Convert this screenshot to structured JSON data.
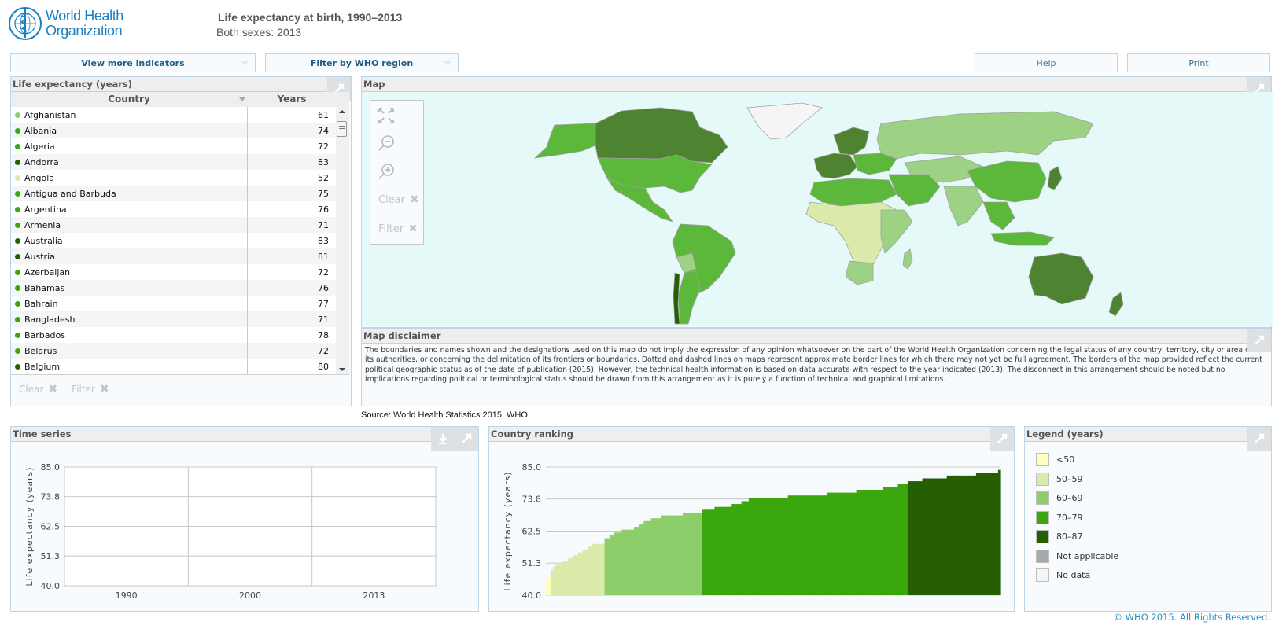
{
  "header": {
    "logo_text_line1": "World Health",
    "logo_text_line2": "Organization",
    "title": "Life expectancy at birth, 1990–2013",
    "subtitle": "Both sexes: 2013"
  },
  "toolbar": {
    "indicators_label": "View more indicators",
    "region_label": "Filter by WHO region",
    "help_label": "Help",
    "print_label": "Print"
  },
  "table_panel": {
    "title": "Life expectancy (years)",
    "col_country": "Country",
    "col_years": "Years",
    "rows": [
      {
        "country": "Afghanistan",
        "years": "61",
        "color": "#8ccf6a"
      },
      {
        "country": "Albania",
        "years": "74",
        "color": "#3aa70c"
      },
      {
        "country": "Algeria",
        "years": "72",
        "color": "#3aa70c"
      },
      {
        "country": "Andorra",
        "years": "83",
        "color": "#265f02"
      },
      {
        "country": "Angola",
        "years": "52",
        "color": "#d9eaab"
      },
      {
        "country": "Antigua and Barbuda",
        "years": "75",
        "color": "#3aa70c"
      },
      {
        "country": "Argentina",
        "years": "76",
        "color": "#3aa70c"
      },
      {
        "country": "Armenia",
        "years": "71",
        "color": "#3aa70c"
      },
      {
        "country": "Australia",
        "years": "83",
        "color": "#265f02"
      },
      {
        "country": "Austria",
        "years": "81",
        "color": "#265f02"
      },
      {
        "country": "Azerbaijan",
        "years": "72",
        "color": "#3aa70c"
      },
      {
        "country": "Bahamas",
        "years": "76",
        "color": "#3aa70c"
      },
      {
        "country": "Bahrain",
        "years": "77",
        "color": "#3aa70c"
      },
      {
        "country": "Bangladesh",
        "years": "71",
        "color": "#3aa70c"
      },
      {
        "country": "Barbados",
        "years": "78",
        "color": "#3aa70c"
      },
      {
        "country": "Belarus",
        "years": "72",
        "color": "#3aa70c"
      },
      {
        "country": "Belgium",
        "years": "80",
        "color": "#265f02"
      }
    ],
    "clear_label": "Clear",
    "filter_label": "Filter"
  },
  "map_panel": {
    "title": "Map",
    "tools": {
      "fullscreen_icon": "expand-arrows-icon",
      "zoom_out_icon": "zoom-out-icon",
      "zoom_in_icon": "zoom-in-icon",
      "clear_label": "Clear",
      "filter_label": "Filter"
    },
    "background_color": "#e6f9f9"
  },
  "disclaimer_panel": {
    "title": "Map disclaimer",
    "text": "The boundaries and names shown and the designations used on this map do not imply the expression of any opinion whatsoever on the part of the World Health Organization concerning the legal status of any country, territory, city or area or of its authorities, or concerning the delimitation of its frontiers or boundaries. Dotted and dashed lines on maps represent approximate border lines for which there may not yet be full agreement. The borders of the map provided reflect the current political geographic status as of the date of publication (2015). However, the technical health information is based on data accurate with respect to the year indicated (2013). The disconnect in this arrangement should be noted but no implications regarding political or terminological status should be drawn from this arrangement as it is purely a function of technical and graphical limitations."
  },
  "source": "Source: World Health Statistics 2015, WHO",
  "legend": {
    "title": "Legend (years)",
    "items": [
      {
        "label": "<50",
        "color": "#ffffbf"
      },
      {
        "label": "50–59",
        "color": "#d9eaab"
      },
      {
        "label": "60–69",
        "color": "#8ccf6a"
      },
      {
        "label": "70–79",
        "color": "#3aa70c"
      },
      {
        "label": "80–87",
        "color": "#265f02"
      },
      {
        "label": "Not applicable",
        "color": "#a9a9a9"
      },
      {
        "label": "No data",
        "color": "#f5f5f5"
      }
    ]
  },
  "copyright": "© WHO 2015. All Rights Reserved.",
  "chart_data": [
    {
      "id": "time-series",
      "type": "line",
      "title": "Time series",
      "xlabel": "",
      "ylabel": "Life expectancy (years)",
      "x": [
        "1990",
        "2000",
        "2013"
      ],
      "yticks": [
        "40.0",
        "51.3",
        "62.5",
        "73.8",
        "85.0"
      ],
      "ylim": [
        40,
        85
      ],
      "grid": true,
      "series": []
    },
    {
      "id": "country-ranking",
      "type": "bar",
      "title": "Country ranking",
      "xlabel": "",
      "ylabel": "Life expectancy (years)",
      "yticks": [
        "40.0",
        "51.3",
        "62.5",
        "73.8",
        "85.0"
      ],
      "ylim": [
        40,
        85
      ],
      "grid": true,
      "bins": [
        {
          "range": "<50",
          "color": "#ffffbf",
          "values": [
            46,
            46
          ]
        },
        {
          "range": "50–59",
          "color": "#d9eaab",
          "values": [
            49,
            50,
            51,
            51,
            51,
            52,
            52,
            53,
            53,
            54,
            54,
            55,
            55,
            56,
            56,
            57,
            57,
            58,
            58,
            58,
            58,
            58
          ]
        },
        {
          "range": "60–69",
          "color": "#8ccf6a",
          "values": [
            60,
            60,
            61,
            61,
            62,
            62,
            62,
            63,
            63,
            63,
            63,
            63,
            64,
            64,
            65,
            65,
            66,
            66,
            66,
            67,
            67,
            67,
            67,
            68,
            68,
            68,
            68,
            68,
            68,
            68,
            68,
            68,
            69,
            69,
            69,
            69,
            69,
            69,
            69,
            69
          ]
        },
        {
          "range": "70–79",
          "color": "#3aa70c",
          "values": [
            70,
            70,
            70,
            70,
            70,
            71,
            71,
            71,
            71,
            71,
            71,
            71,
            72,
            72,
            72,
            72,
            73,
            73,
            73,
            74,
            74,
            74,
            74,
            74,
            74,
            74,
            74,
            74,
            74,
            74,
            74,
            74,
            74,
            74,
            74,
            75,
            75,
            75,
            75,
            75,
            75,
            75,
            75,
            75,
            75,
            75,
            75,
            75,
            75,
            75,
            75,
            76,
            76,
            76,
            76,
            76,
            76,
            76,
            76,
            76,
            76,
            76,
            76,
            77,
            77,
            77,
            77,
            77,
            77,
            77,
            77,
            77,
            77,
            77,
            78,
            78,
            78,
            78,
            78,
            78,
            79,
            79,
            79,
            79
          ]
        },
        {
          "range": "80–87",
          "color": "#265f02",
          "values": [
            80,
            80,
            80,
            80,
            80,
            80,
            81,
            81,
            81,
            81,
            81,
            81,
            81,
            81,
            81,
            81,
            82,
            82,
            82,
            82,
            82,
            82,
            82,
            82,
            82,
            82,
            82,
            82,
            83,
            83,
            83,
            83,
            83,
            83,
            83,
            83,
            83,
            84
          ]
        }
      ]
    }
  ]
}
